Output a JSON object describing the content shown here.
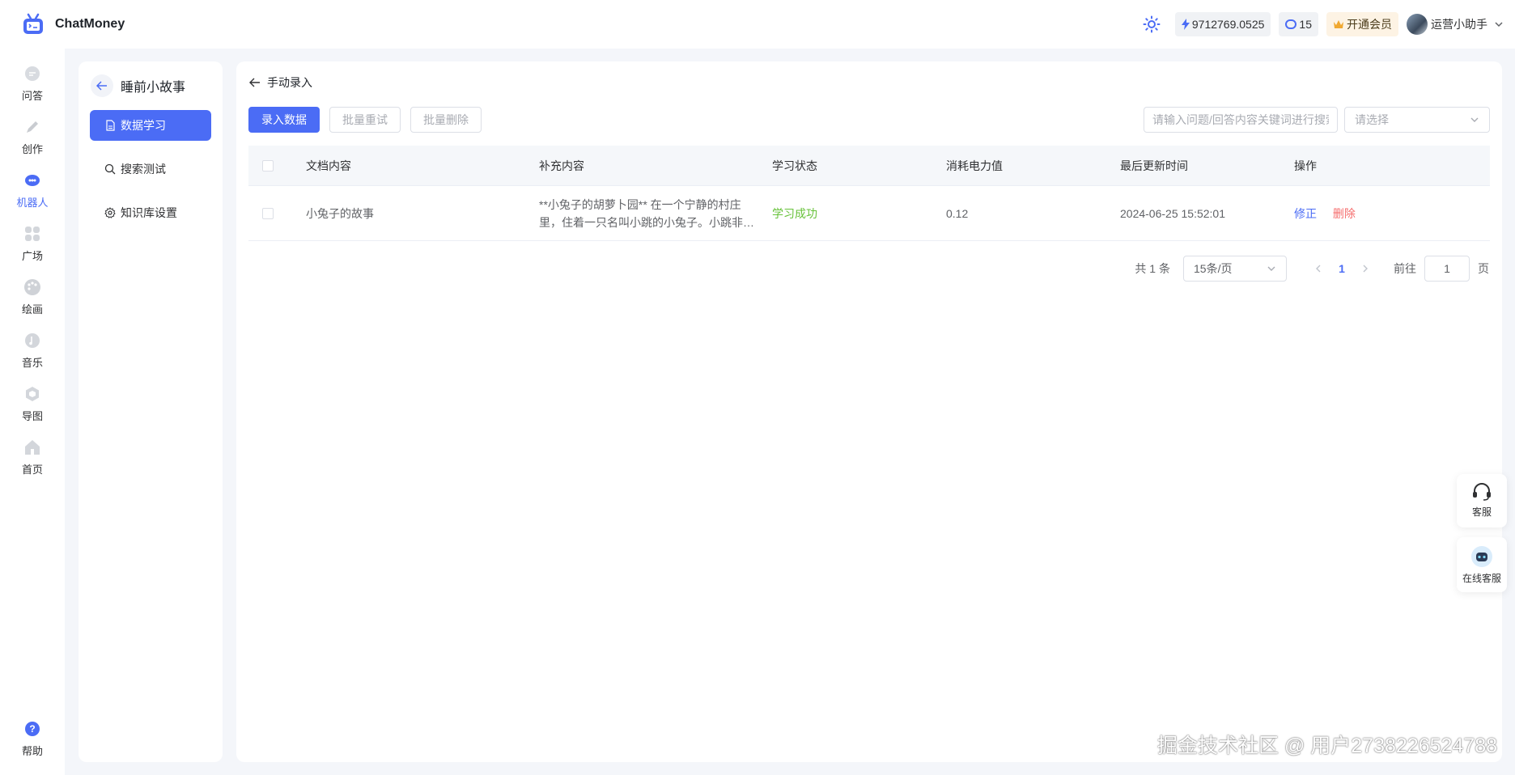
{
  "app": {
    "name": "ChatMoney"
  },
  "header": {
    "power_balance": "9712769.0525",
    "message_count": "15",
    "vip_label": "开通会员",
    "user_name": "运营小助手"
  },
  "nav": {
    "items": [
      {
        "label": "问答",
        "icon": "chat-icon"
      },
      {
        "label": "创作",
        "icon": "pen-icon"
      },
      {
        "label": "机器人",
        "icon": "robot-icon"
      },
      {
        "label": "广场",
        "icon": "grid-icon"
      },
      {
        "label": "绘画",
        "icon": "palette-icon"
      },
      {
        "label": "音乐",
        "icon": "music-icon"
      },
      {
        "label": "导图",
        "icon": "mindmap-icon"
      },
      {
        "label": "首页",
        "icon": "home-icon"
      }
    ],
    "help_label": "帮助"
  },
  "kb": {
    "title": "睡前小故事",
    "menu": [
      {
        "label": "数据学习"
      },
      {
        "label": "搜索测试"
      },
      {
        "label": "知识库设置"
      }
    ]
  },
  "content": {
    "breadcrumb": "手动录入",
    "toolbar": {
      "add_label": "录入数据",
      "retry_label": "批量重试",
      "delete_label": "批量删除"
    },
    "search_placeholder": "请输入问题/回答内容关键词进行搜索",
    "select_placeholder": "请选择",
    "table": {
      "headers": [
        "文档内容",
        "补充内容",
        "学习状态",
        "消耗电力值",
        "最后更新时间",
        "操作"
      ],
      "rows": [
        {
          "doc": "小兔子的故事",
          "supplement": "**小兔子的胡萝卜园** 在一个宁静的村庄里，住着一只名叫小跳的小兔子。小跳非常喜欢胡萝卜",
          "status": "学习成功",
          "cost": "0.12",
          "updated": "2024-06-25 15:52:01",
          "edit": "修正",
          "delete": "删除"
        }
      ]
    },
    "pager": {
      "total": "共 1 条",
      "page_size": "15条/页",
      "current": "1",
      "goto_label": "前往",
      "goto_value": "1",
      "page_unit": "页"
    }
  },
  "float": {
    "service_label": "客服",
    "online_label": "在线客服"
  },
  "watermark": "掘金技术社区 @ 用户2738226524788",
  "colors": {
    "primary": "#4b6cf5",
    "success": "#67c23a",
    "danger": "#f56c6c"
  }
}
